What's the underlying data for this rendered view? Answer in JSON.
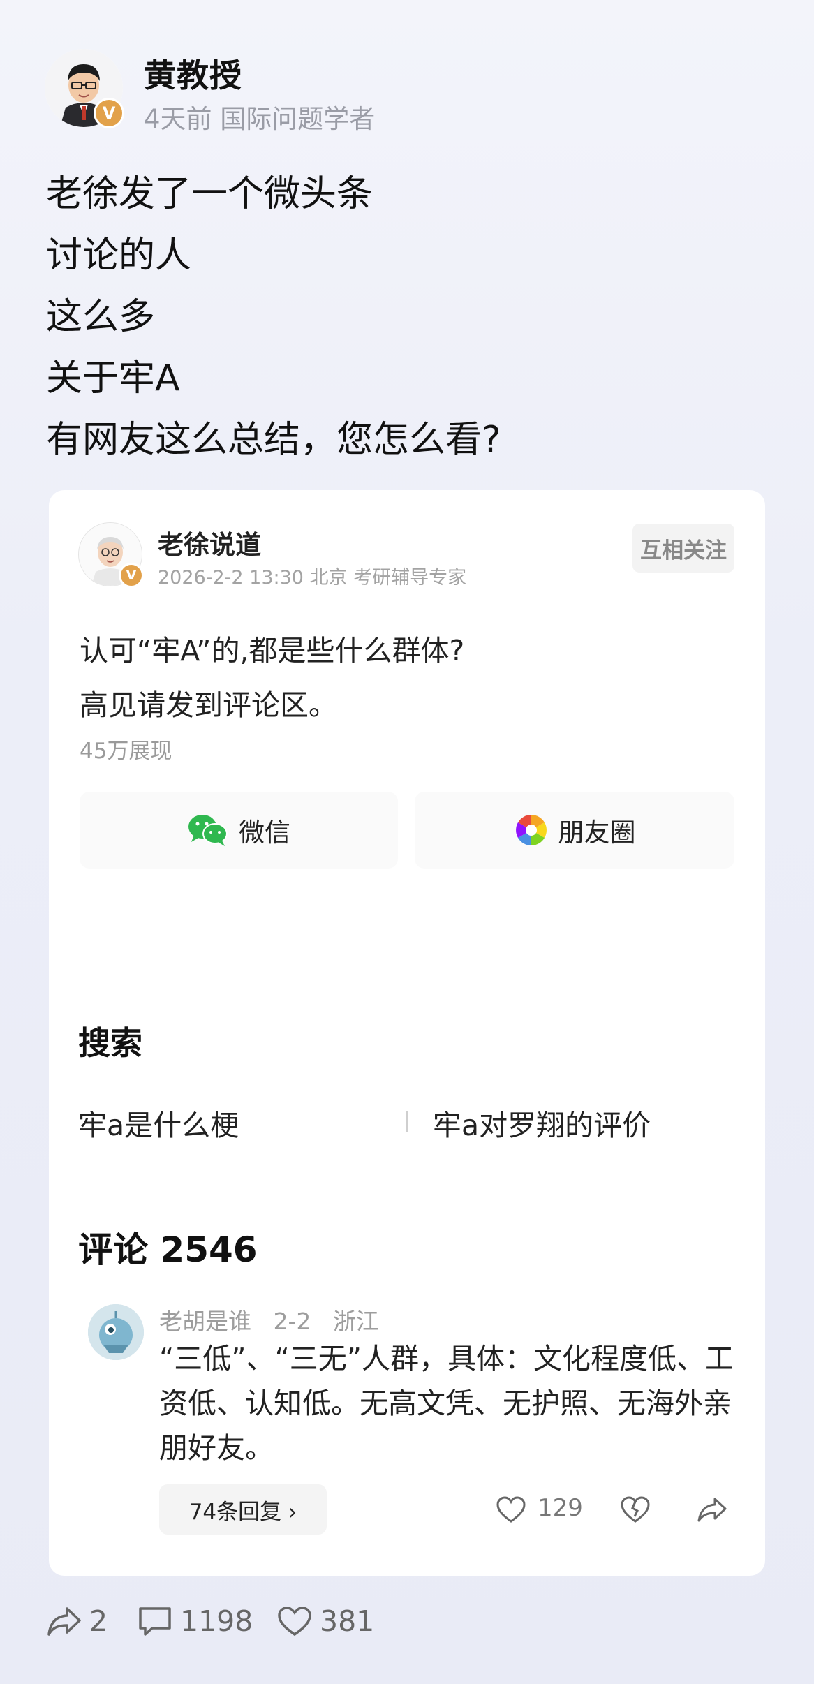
{
  "author": {
    "name": "黄教授",
    "meta": "4天前 国际问题学者",
    "badge": "V"
  },
  "post_lines": [
    "老徐发了一个微头条",
    "讨论的人",
    "这么多",
    "关于牢A",
    "有网友这么总结，您怎么看?"
  ],
  "card": {
    "author_name": "老徐说道",
    "author_meta": "2026-2-2 13:30 北京 考研辅导专家",
    "badge": "V",
    "follow_label": "互相关注",
    "question_line1": "认可“牢A”的,都是些什么群体?",
    "question_line2": "高见请发到评论区。",
    "views": "45万展现",
    "share_wechat": "微信",
    "share_moments": "朋友圈",
    "search_heading": "搜索",
    "search_items": [
      "牢a是什么梗",
      "牢a对罗翔的评价"
    ],
    "comments_heading": "评论 2546",
    "comment": {
      "meta": "老胡是谁   2-2   浙江",
      "body": "“三低”、“三无”人群，具体：文化程度低、工资低、认知低。无高文凭、无护照、无海外亲朋好友。",
      "replies": "74条回复 ›",
      "likes": "129"
    }
  },
  "bottom_bar": {
    "shares": "2",
    "comments": "1198",
    "likes": "381"
  },
  "colors": {
    "accent_badge": "#e2a14a",
    "wechat_green": "#2fb84f"
  }
}
